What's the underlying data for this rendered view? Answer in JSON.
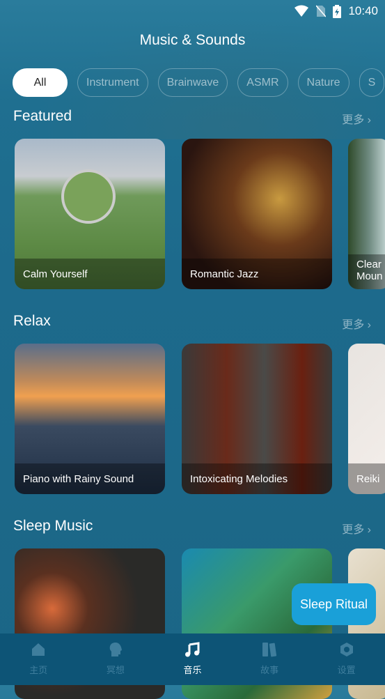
{
  "status": {
    "time": "10:40",
    "icons": [
      "wifi-icon",
      "no-sim-icon",
      "battery-charging-icon"
    ]
  },
  "header": {
    "title": "Music & Sounds"
  },
  "categories": [
    {
      "label": "All",
      "active": true
    },
    {
      "label": "Instrument"
    },
    {
      "label": "Brainwave"
    },
    {
      "label": "ASMR"
    },
    {
      "label": "Nature"
    },
    {
      "label": "S"
    }
  ],
  "sections": [
    {
      "title": "Featured",
      "more": "更多",
      "cards": [
        "Calm Yourself",
        "Romantic Jazz",
        "Clear Moun"
      ]
    },
    {
      "title": "Relax",
      "more": "更多",
      "cards": [
        "Piano with Rainy Sound",
        "Intoxicating Melodies",
        "Reiki"
      ]
    },
    {
      "title": "Sleep Music",
      "more": "更多",
      "cards": [
        "",
        "",
        ""
      ]
    }
  ],
  "floating_button": "Sleep Ritual",
  "nav": [
    {
      "label": "主页",
      "icon": "home-icon"
    },
    {
      "label": "冥想",
      "icon": "meditation-head-icon"
    },
    {
      "label": "音乐",
      "icon": "music-note-icon",
      "active": true
    },
    {
      "label": "故事",
      "icon": "books-icon"
    },
    {
      "label": "设置",
      "icon": "settings-icon"
    }
  ],
  "colors": {
    "background": "#1d6a8c",
    "nav": "#0d5476",
    "accent": "#1aa0d8"
  }
}
